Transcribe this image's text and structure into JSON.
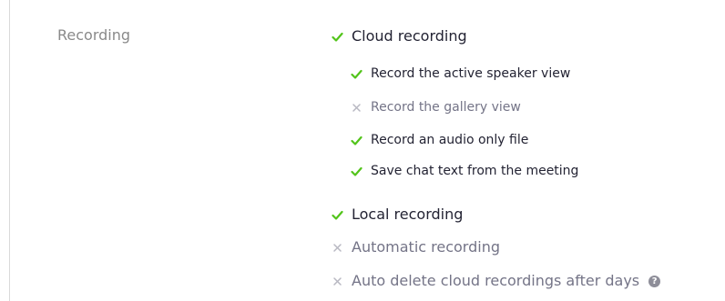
{
  "section": {
    "label": "Recording"
  },
  "settings": {
    "cloud_recording": {
      "label": "Cloud recording",
      "enabled": true
    },
    "active_speaker": {
      "label": "Record the active speaker view",
      "enabled": true
    },
    "gallery_view": {
      "label": "Record the gallery view",
      "enabled": false
    },
    "audio_only": {
      "label": "Record an audio only file",
      "enabled": true
    },
    "save_chat": {
      "label": "Save chat text from the meeting",
      "enabled": true
    },
    "local_recording": {
      "label": "Local recording",
      "enabled": true
    },
    "automatic_recording": {
      "label": "Automatic recording",
      "enabled": false
    },
    "auto_delete": {
      "label": "Auto delete cloud recordings after days",
      "enabled": false,
      "help_glyph": "?"
    }
  },
  "colors": {
    "check": "#52c41a",
    "cross": "#b8b8c2",
    "text_on": "#232333",
    "text_off": "#747487",
    "section_label": "#8a8a8a",
    "help_badge": "#8e8e99"
  },
  "icons": {
    "enabled": "check-icon",
    "disabled": "cross-icon",
    "help": "question-circle-icon"
  }
}
